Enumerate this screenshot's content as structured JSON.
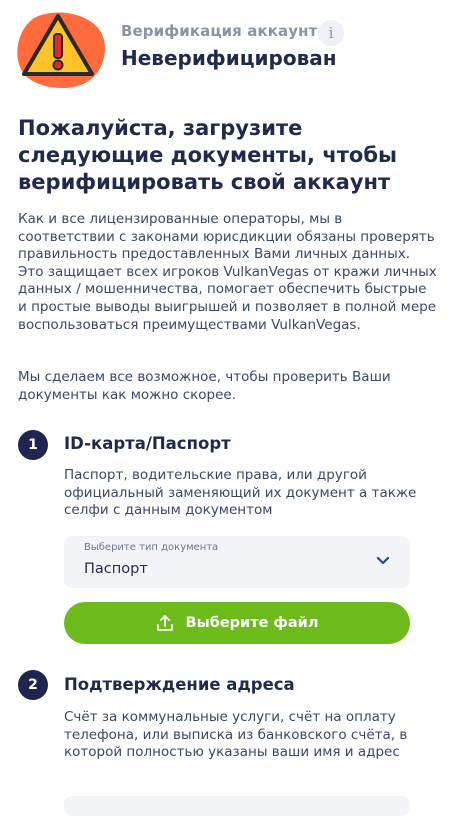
{
  "header": {
    "warning_icon": "warning-triangle-icon",
    "status_label": "Верификация аккаунта",
    "info_glyph": "i",
    "status_value": "Неверифицирован",
    "colors": {
      "warning_blob": "#ff6b3d",
      "warning_triangle": "#ffc229",
      "warning_mark": "#e0282a"
    }
  },
  "main": {
    "title": "Пожалуйста, загрузите следующие документы, чтобы верифицировать свой аккаунт",
    "intro": "Как и все лицензированные операторы, мы в соответствии с законами юрисдикции обязаны проверять правильность предоставленных Вами личных данных. Это защищает всех игроков VulkanVegas от кражи личных данных / мошенничества, помогает обеспечить быстрые и простые выводы выигрышей и позволяет в полной мере воспользоваться преимуществами VulkanVegas.",
    "intro2": "Мы сделаем все возможное, чтобы проверить Ваши документы как можно скорее."
  },
  "steps": [
    {
      "number": "1",
      "title": "ID-карта/Паспорт",
      "description": "Паспорт, водительские права, или другой официальный заменяющий их документ а также селфи с данным документом",
      "select_caption": "Выберите тип документа",
      "select_value": "Паспорт",
      "upload_label": "Выберите файл"
    },
    {
      "number": "2",
      "title": "Подтверждение адреса",
      "description": "Счёт за коммунальные услуги, счёт на оплату телефона, или выписка из банковского счёта, в которой полностью указаны ваши имя и адрес"
    }
  ],
  "colors": {
    "accent_green": "#6dbb1a",
    "step_badge": "#1f2550",
    "text_dark": "#1f2a4d"
  }
}
